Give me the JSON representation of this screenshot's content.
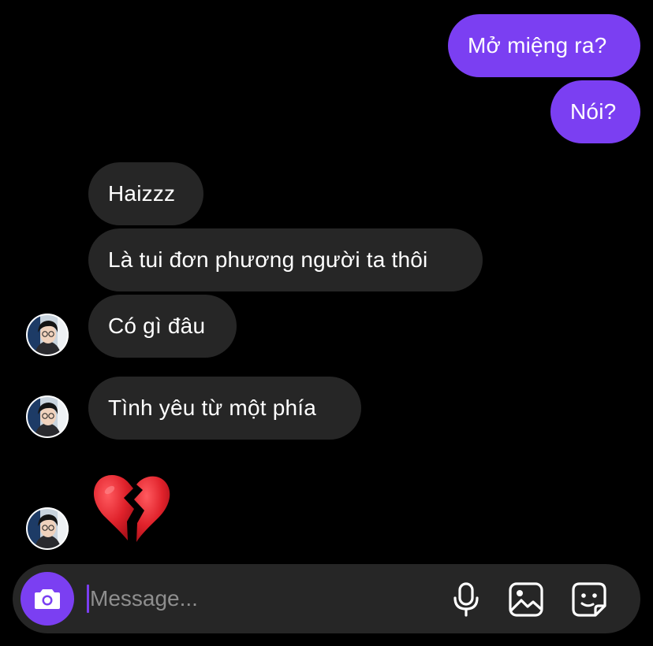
{
  "thread": {
    "outgoing": [
      {
        "text": "Mở miệng ra?"
      },
      {
        "text": "Nói?"
      }
    ],
    "incoming": [
      {
        "text": "Haizzz"
      },
      {
        "text": "Là tui đơn phương người ta thôi"
      },
      {
        "text": "Có gì đâu"
      },
      {
        "text": "Tình yêu từ một phía"
      }
    ],
    "reaction_emoji": "broken-heart"
  },
  "composer": {
    "placeholder": "Message..."
  },
  "icons": {
    "camera": "camera-icon",
    "microphone": "microphone-icon",
    "gallery": "image-icon",
    "sticker": "sticker-icon"
  },
  "colors": {
    "background": "#000000",
    "outgoing_bubble": "#7b3ff2",
    "incoming_bubble": "#262626",
    "composer": "#262626",
    "accent": "#7b3ff2",
    "placeholder": "#8e8e8e",
    "broken_heart": "#e0222b"
  }
}
